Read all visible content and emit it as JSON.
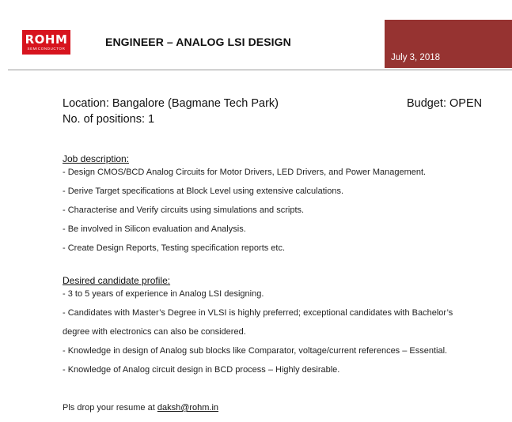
{
  "header": {
    "logo_text": "ROHM",
    "logo_subtext": "SEMICONDUCTOR",
    "title": "ENGINEER – ANALOG LSI DESIGN",
    "date": "July 3, 2018",
    "accent_color": "#963331",
    "logo_color": "#d7141e"
  },
  "info": {
    "location": "Location: Bangalore (Bagmane Tech Park)",
    "budget": "Budget: OPEN",
    "positions": "No. of positions: 1"
  },
  "job_description": {
    "heading": "Job description:",
    "items": [
      "- Design CMOS/BCD Analog Circuits for Motor Drivers, LED Drivers, and Power Management.",
      "- Derive Target specifications at Block Level using extensive calculations.",
      "- Characterise and Verify circuits using simulations and scripts.",
      "- Be involved in Silicon evaluation and Analysis.",
      "- Create Design Reports, Testing specification reports etc."
    ]
  },
  "candidate_profile": {
    "heading": "Desired candidate profile:",
    "items": [
      "- 3 to 5 years of experience in Analog LSI designing.",
      "- Candidates with Master’s Degree in VLSI is highly preferred; exceptional candidates with Bachelor’s",
      "degree with electronics can also be considered.",
      "- Knowledge in design of Analog sub blocks like Comparator, voltage/current references – Essential.",
      "- Knowledge of Analog circuit design in BCD process – Highly desirable."
    ]
  },
  "footer": {
    "text": "Pls drop your resume at ",
    "email": "daksh@rohm.in"
  }
}
